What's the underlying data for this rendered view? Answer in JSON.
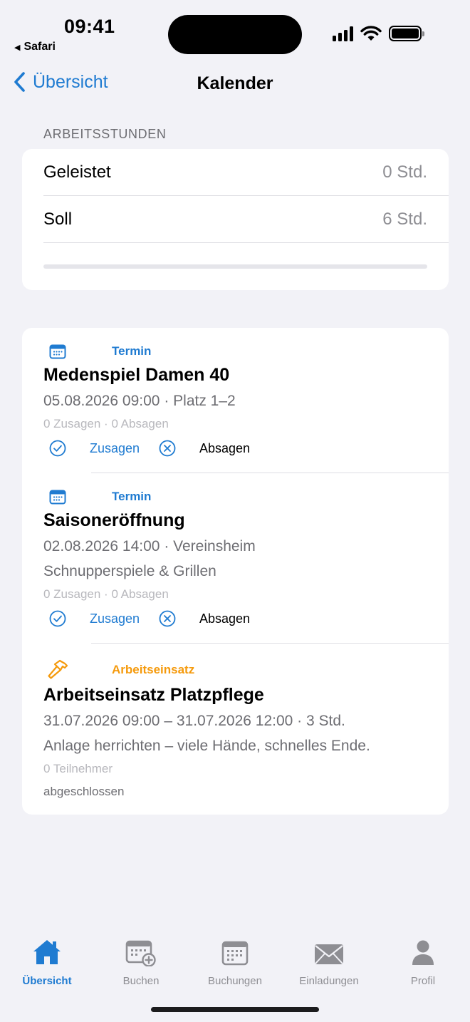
{
  "status_bar": {
    "time": "09:41",
    "back_app": "Safari"
  },
  "nav": {
    "back_label": "Übersicht",
    "title": "Kalender"
  },
  "work_hours": {
    "section_label": "ARBEITSSTUNDEN",
    "rows": [
      {
        "label": "Geleistet",
        "value": "0 Std."
      },
      {
        "label": "Soll",
        "value": "6 Std."
      }
    ],
    "progress_fraction": 0
  },
  "events": [
    {
      "kind": "Termin",
      "kind_icon": "calendar-icon",
      "title": "Medenspiel Damen 40",
      "when": "05.08.2026 09:00 · Platz 1–2",
      "counts": "0 Zusagen · 0 Absagen",
      "accept_label": "Zusagen",
      "decline_label": "Absagen"
    },
    {
      "kind": "Termin",
      "kind_icon": "calendar-icon",
      "title": "Saisoneröffnung",
      "when": "02.08.2026 14:00 · Vereinsheim",
      "description": "Schnupperspiele & Grillen",
      "counts": "0 Zusagen · 0 Absagen",
      "accept_label": "Zusagen",
      "decline_label": "Absagen"
    },
    {
      "kind": "Arbeitseinsatz",
      "kind_icon": "hammer-icon",
      "title": "Arbeitseinsatz Platzpflege",
      "when": "31.07.2026 09:00 – 31.07.2026 12:00 · 3 Std.",
      "description": "Anlage herrichten – viele Hände, schnelles Ende.",
      "counts": "0 Teilnehmer",
      "status": "abgeschlossen"
    }
  ],
  "tabbar": {
    "items": [
      {
        "label": "Übersicht",
        "icon": "home-icon",
        "active": true
      },
      {
        "label": "Buchen",
        "icon": "calendar-add-icon",
        "active": false
      },
      {
        "label": "Buchungen",
        "icon": "calendar-icon",
        "active": false
      },
      {
        "label": "Einladungen",
        "icon": "envelope-icon",
        "active": false
      },
      {
        "label": "Profil",
        "icon": "person-icon",
        "active": false
      }
    ]
  },
  "colors": {
    "accent": "#1f7bd1",
    "work_accent": "#f59a0c",
    "background": "#f2f2f7",
    "inactive_tab": "#8e8e93"
  }
}
